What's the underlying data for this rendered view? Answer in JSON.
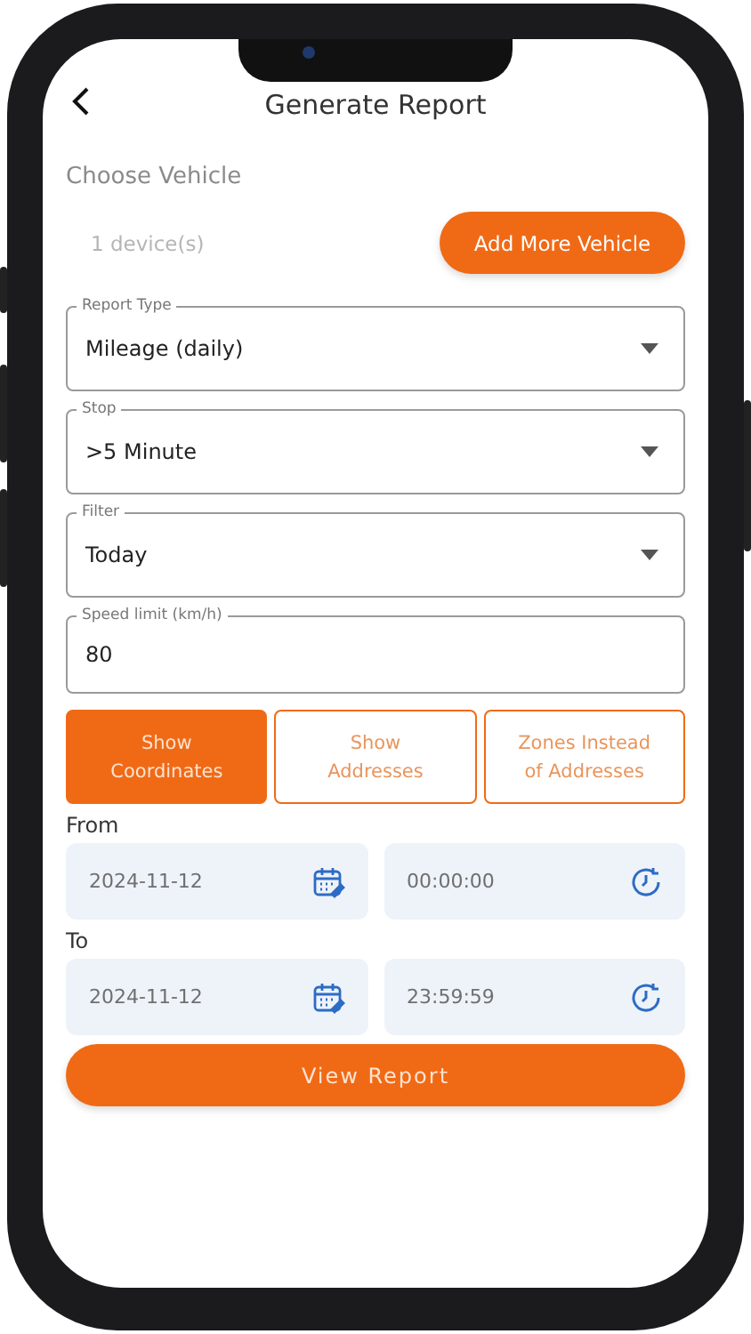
{
  "header": {
    "title": "Generate Report"
  },
  "vehicle": {
    "label": "Choose Vehicle",
    "count": "1 device(s)",
    "button": "Add More Vehicle"
  },
  "fields": [
    {
      "kind": "select",
      "label": "Report Type",
      "value": "Mileage (daily)"
    },
    {
      "kind": "select",
      "label": "Stop",
      "value": ">5 Minute"
    },
    {
      "kind": "select",
      "label": "Filter",
      "value": "Today"
    },
    {
      "kind": "input",
      "label": "Speed limit (km/h)",
      "value": "80"
    }
  ],
  "display_options": [
    {
      "label": "Show Coordinates",
      "selected": true
    },
    {
      "label": "Show Addresses",
      "selected": false
    },
    {
      "label": "Zones Instead of Addresses",
      "selected": false
    }
  ],
  "ranges": [
    {
      "label": "From",
      "inputs": [
        {
          "kind": "date",
          "value": "2024-11-12"
        },
        {
          "kind": "time",
          "value": "00:00:00"
        }
      ]
    },
    {
      "label": "To",
      "inputs": [
        {
          "kind": "date",
          "value": "2024-11-12"
        },
        {
          "kind": "time",
          "value": "23:59:59"
        }
      ]
    }
  ],
  "submit": "View Report"
}
